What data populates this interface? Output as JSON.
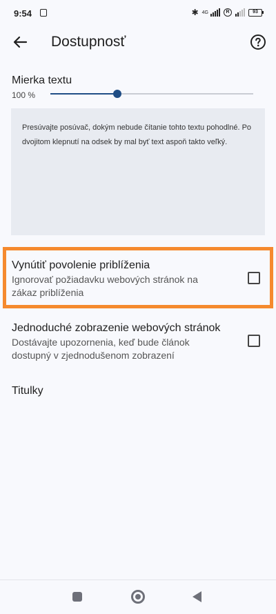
{
  "status_bar": {
    "time": "9:54",
    "network_label": "4G",
    "roaming_badge": "R",
    "battery": "93"
  },
  "app_bar": {
    "title": "Dostupnosť",
    "back_icon": "arrow-left-icon",
    "help_icon": "help-circle-icon"
  },
  "text_scale": {
    "label": "Mierka textu",
    "value_text": "100 %",
    "slider_fraction": 0.33,
    "preview_text": "Presúvajte posúvač, dokým nebude čítanie tohto textu pohodlné. Po dvojitom klepnutí na odsek by mal byť text aspoň takto veľký."
  },
  "settings": [
    {
      "title": "Vynútiť povolenie priblíženia",
      "subtitle": "Ignorovať požiadavku webových stránok na zákaz priblíženia",
      "checked": false
    },
    {
      "title": "Jednoduché zobrazenie webových stránok",
      "subtitle": "Dostávajte upozornenia, keď bude článok dostupný v zjednodušenom zobrazení",
      "checked": false
    }
  ],
  "captions_label": "Titulky",
  "colors": {
    "accent": "#1f4d85",
    "highlight_border": "#f58a2e",
    "background": "#f8f9fd",
    "preview_bg": "#e8ebf1"
  },
  "nav_bar": {
    "recents_icon": "square-icon",
    "home_icon": "circle-icon",
    "back_icon": "triangle-back-icon"
  }
}
